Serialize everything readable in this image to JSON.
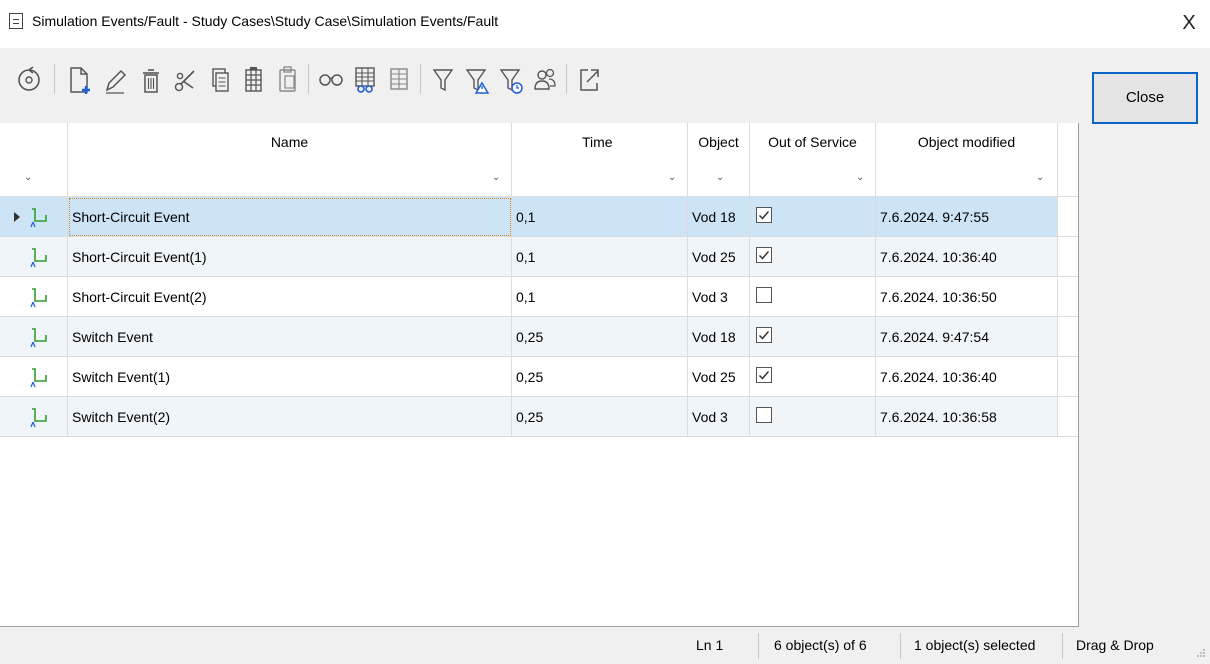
{
  "window": {
    "title": "Simulation Events/Fault - Study Cases\\Study Case\\Simulation Events/Fault",
    "close_glyph": "X"
  },
  "toolbar": {
    "buttons": [
      {
        "name": "refresh-icon"
      },
      {
        "name": "new-object-icon"
      },
      {
        "name": "edit-pencil-icon"
      },
      {
        "name": "delete-trash-icon"
      },
      {
        "name": "cut-scissors-icon"
      },
      {
        "name": "copy-icon"
      },
      {
        "name": "copy-table-icon"
      },
      {
        "name": "paste-icon"
      },
      {
        "name": "view-glasses-icon"
      },
      {
        "name": "table-view-icon"
      },
      {
        "name": "table-layout-icon"
      },
      {
        "name": "filter-icon"
      },
      {
        "name": "filter-warning-icon"
      },
      {
        "name": "filter-time-icon"
      },
      {
        "name": "users-icon"
      },
      {
        "name": "export-window-icon"
      }
    ]
  },
  "close_button": {
    "label": "Close"
  },
  "table": {
    "columns": [
      {
        "key": "icon",
        "label": ""
      },
      {
        "key": "name",
        "label": "Name"
      },
      {
        "key": "time",
        "label": "Time"
      },
      {
        "key": "object",
        "label": "Object"
      },
      {
        "key": "out_of_service",
        "label": "Out of Service"
      },
      {
        "key": "modified",
        "label": "Object modified"
      }
    ],
    "rows": [
      {
        "name": "Short-Circuit Event",
        "time": "0,1",
        "object": "Vod 18",
        "out_of_service": true,
        "modified": "7.6.2024. 9:47:55",
        "selected": true
      },
      {
        "name": "Short-Circuit Event(1)",
        "time": "0,1",
        "object": "Vod 25",
        "out_of_service": true,
        "modified": "7.6.2024. 10:36:40",
        "selected": false
      },
      {
        "name": "Short-Circuit Event(2)",
        "time": "0,1",
        "object": "Vod 3",
        "out_of_service": false,
        "modified": "7.6.2024. 10:36:50",
        "selected": false
      },
      {
        "name": "Switch Event",
        "time": "0,25",
        "object": "Vod 18",
        "out_of_service": true,
        "modified": "7.6.2024. 9:47:54",
        "selected": false
      },
      {
        "name": "Switch Event(1)",
        "time": "0,25",
        "object": "Vod 25",
        "out_of_service": true,
        "modified": "7.6.2024. 10:36:40",
        "selected": false
      },
      {
        "name": "Switch Event(2)",
        "time": "0,25",
        "object": "Vod 3",
        "out_of_service": false,
        "modified": "7.6.2024. 10:36:58",
        "selected": false
      }
    ]
  },
  "status": {
    "line": "Ln 1",
    "count": "6 object(s) of 6",
    "selected": "1 object(s) selected",
    "mode": "Drag & Drop"
  },
  "colors": {
    "selection": "#cde4f6",
    "accent": "#0a64c8",
    "icon_green": "#2f9e2f",
    "icon_blue": "#1f5fd6"
  }
}
